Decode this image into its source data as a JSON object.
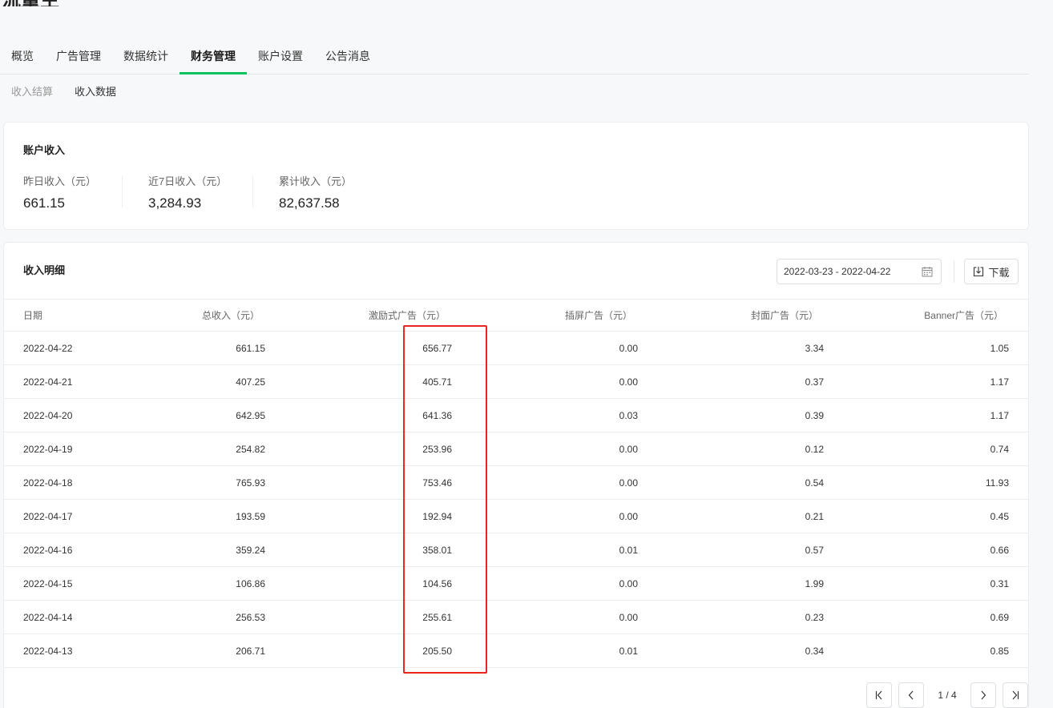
{
  "page": {
    "title": "流量主"
  },
  "main_tabs": [
    {
      "label": "概览"
    },
    {
      "label": "广告管理"
    },
    {
      "label": "数据统计"
    },
    {
      "label": "财务管理",
      "active": true
    },
    {
      "label": "账户设置"
    },
    {
      "label": "公告消息"
    }
  ],
  "sub_tabs": [
    {
      "label": "收入结算"
    },
    {
      "label": "收入数据",
      "active": true
    }
  ],
  "summary": {
    "title": "账户收入",
    "stats": [
      {
        "label": "昨日收入（元）",
        "value": "661.15"
      },
      {
        "label": "近7日收入（元）",
        "value": "3,284.93"
      },
      {
        "label": "累计收入（元）",
        "value": "82,637.58"
      }
    ]
  },
  "detail": {
    "title": "收入明细",
    "date_range": "2022-03-23 - 2022-04-22",
    "download_label": "下载",
    "columns": [
      "日期",
      "总收入（元）",
      "激励式广告（元）",
      "插屏广告（元）",
      "封面广告（元）",
      "Banner广告（元）"
    ],
    "rows": [
      [
        "2022-04-22",
        "661.15",
        "656.77",
        "0.00",
        "3.34",
        "1.05"
      ],
      [
        "2022-04-21",
        "407.25",
        "405.71",
        "0.00",
        "0.37",
        "1.17"
      ],
      [
        "2022-04-20",
        "642.95",
        "641.36",
        "0.03",
        "0.39",
        "1.17"
      ],
      [
        "2022-04-19",
        "254.82",
        "253.96",
        "0.00",
        "0.12",
        "0.74"
      ],
      [
        "2022-04-18",
        "765.93",
        "753.46",
        "0.00",
        "0.54",
        "11.93"
      ],
      [
        "2022-04-17",
        "193.59",
        "192.94",
        "0.00",
        "0.21",
        "0.45"
      ],
      [
        "2022-04-16",
        "359.24",
        "358.01",
        "0.01",
        "0.57",
        "0.66"
      ],
      [
        "2022-04-15",
        "106.86",
        "104.56",
        "0.00",
        "1.99",
        "0.31"
      ],
      [
        "2022-04-14",
        "256.53",
        "255.61",
        "0.00",
        "0.23",
        "0.69"
      ],
      [
        "2022-04-13",
        "206.71",
        "205.50",
        "0.01",
        "0.34",
        "0.85"
      ]
    ]
  },
  "pagination": {
    "text": "1 / 4"
  },
  "colors": {
    "accent": "#07c160",
    "highlight": "#e8261f"
  },
  "icons": [
    "calendar-icon",
    "download-icon",
    "first-page-icon",
    "prev-page-icon",
    "next-page-icon",
    "last-page-icon"
  ]
}
